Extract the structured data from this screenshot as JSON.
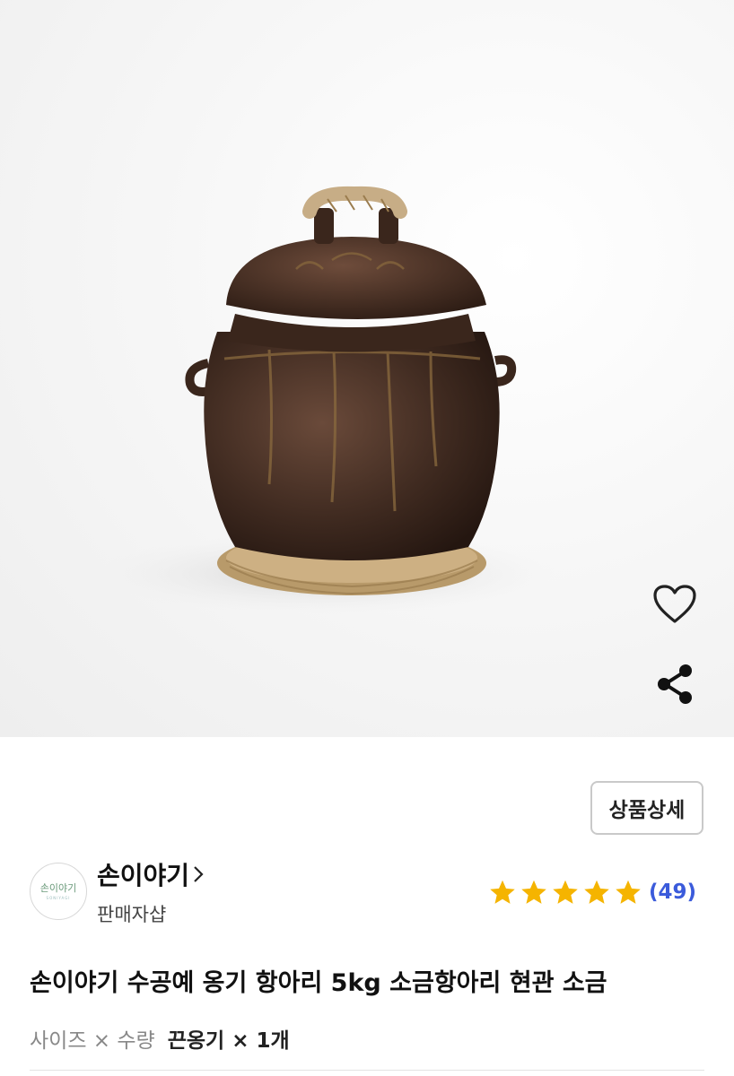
{
  "product_image": {
    "alt": "brown onggi jar with lid on woven straw ring"
  },
  "actions": {
    "heart_icon": "heart-outline-icon",
    "share_icon": "share-icon"
  },
  "detail_button": {
    "label": "상품상세"
  },
  "seller": {
    "logo_text": "손이야기",
    "logo_sub": "SONIYAGI",
    "name": "손이야기",
    "type": "판매자샵"
  },
  "rating": {
    "stars": 5,
    "count": "(49)",
    "star_color": "#f5b400",
    "count_color": "#3b5bdb"
  },
  "product": {
    "title": "손이야기 수공예 옹기 항아리 5kg 소금항아리 현관 소금",
    "option_label": "사이즈 × 수량",
    "option_value": "끈옹기 × 1개"
  }
}
